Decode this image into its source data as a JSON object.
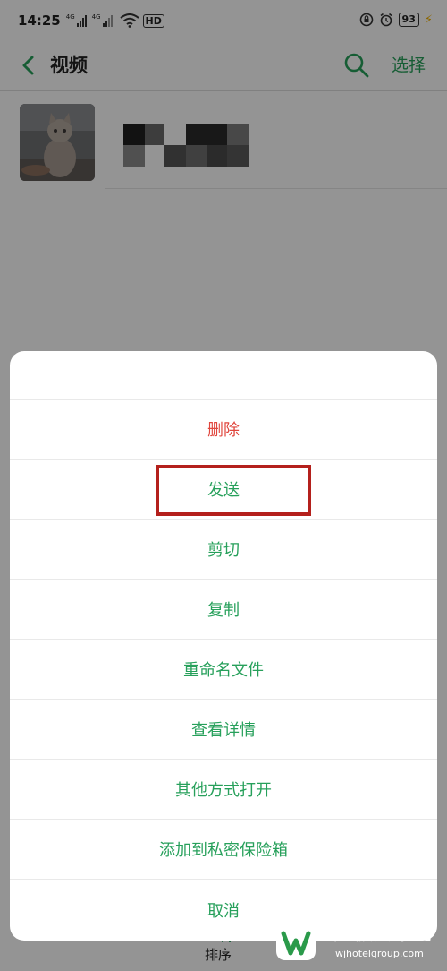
{
  "status_bar": {
    "time": "14:25",
    "sim1": "4G",
    "sim2": "4G",
    "wifi_icon": "wifi-icon",
    "hd_label": "HD",
    "lock_icon": "rotation-lock-icon",
    "alarm_icon": "alarm-icon",
    "battery": "93"
  },
  "header": {
    "title": "视频",
    "back_icon": "chevron-left-icon",
    "search_icon": "search-icon",
    "select_label": "选择"
  },
  "file_list": [
    {
      "thumbnail": "cat-photo",
      "name_redacted": true
    }
  ],
  "action_sheet": {
    "items": [
      {
        "label": "删除",
        "danger": true
      },
      {
        "label": "发送",
        "highlighted": true
      },
      {
        "label": "剪切"
      },
      {
        "label": "复制"
      },
      {
        "label": "重命名文件"
      },
      {
        "label": "查看详情"
      },
      {
        "label": "其他方式打开"
      },
      {
        "label": "添加到私密保险箱"
      },
      {
        "label": "取消"
      }
    ]
  },
  "bottom_bar": {
    "sort_label": "排序",
    "sort_icon": "sort-icon"
  },
  "watermark": {
    "name": "无极安卓网",
    "url": "wjhotelgroup.com"
  },
  "colors": {
    "accent": "#27a05b",
    "danger": "#e0463d",
    "highlight_box": "#b4201c",
    "overlay": "rgba(0,0,0,0.42)"
  }
}
